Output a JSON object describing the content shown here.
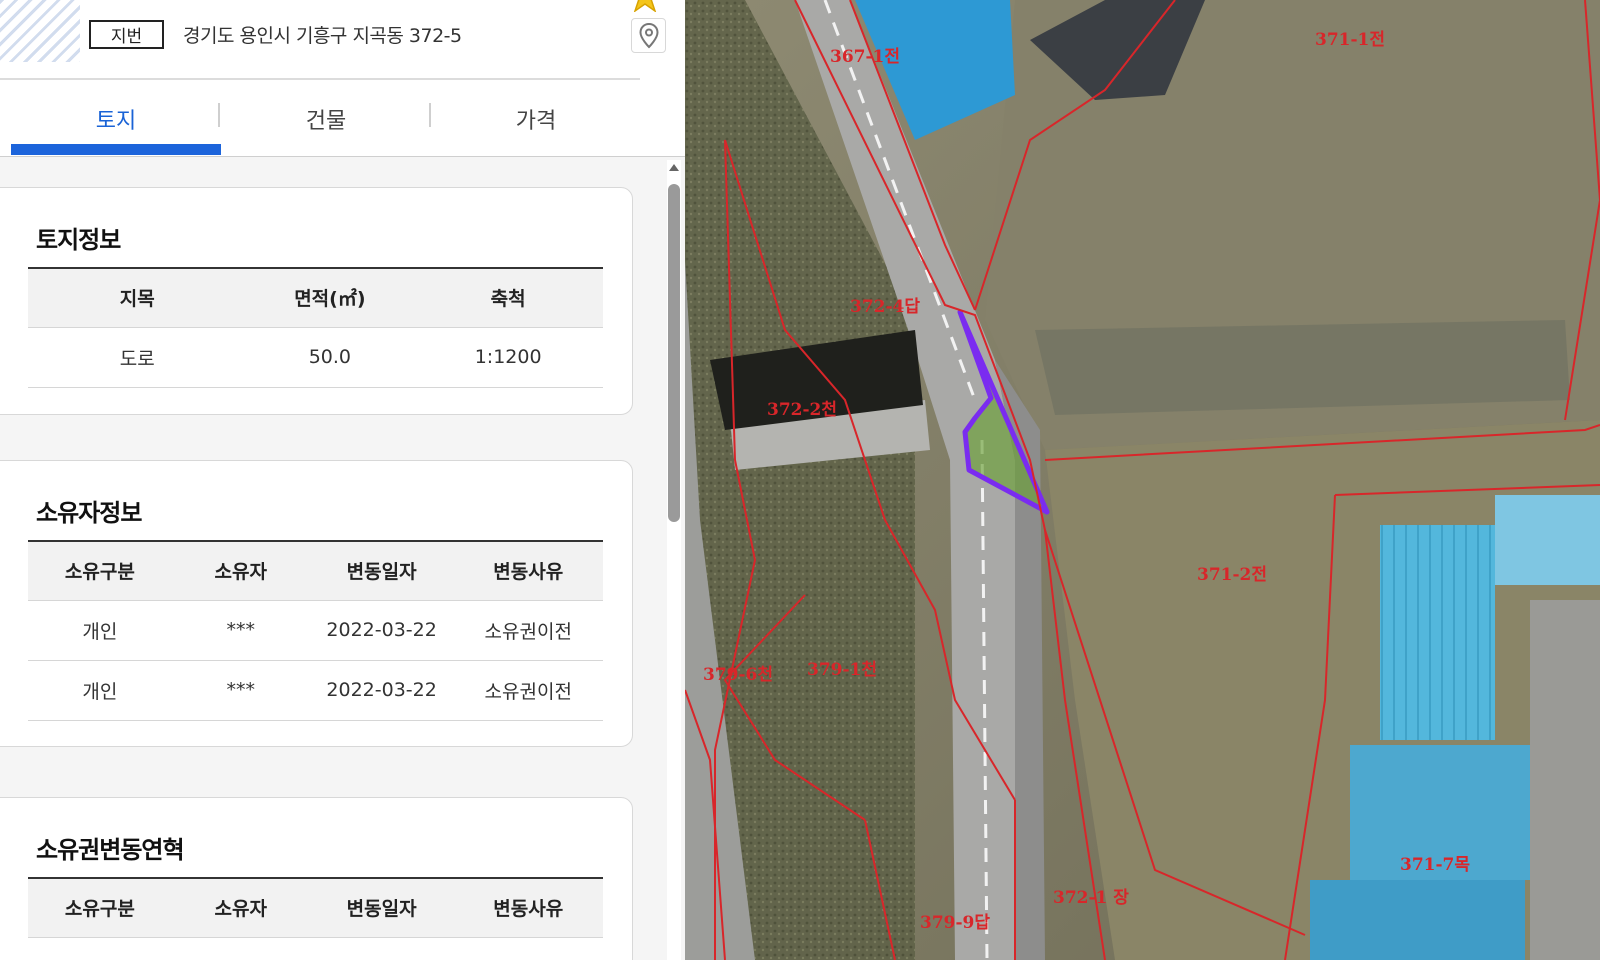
{
  "header": {
    "badge": "지번",
    "address": "경기도 용인시 기흥구 지곡동 372-5"
  },
  "tabs": [
    {
      "label": "토지",
      "active": true
    },
    {
      "label": "건물",
      "active": false
    },
    {
      "label": "가격",
      "active": false
    }
  ],
  "land_info": {
    "title": "토지정보",
    "headers": [
      "지목",
      "면적(㎡)",
      "축척"
    ],
    "row": [
      "도로",
      "50.0",
      "1:1200"
    ]
  },
  "owner_info": {
    "title": "소유자정보",
    "headers": [
      "소유구분",
      "소유자",
      "변동일자",
      "변동사유"
    ],
    "rows": [
      [
        "개인",
        "***",
        "2022-03-22",
        "소유권이전"
      ],
      [
        "개인",
        "***",
        "2022-03-22",
        "소유권이전"
      ]
    ]
  },
  "ownership_history": {
    "title": "소유권변동연혁",
    "headers": [
      "소유구분",
      "소유자",
      "변동일자",
      "변동사유"
    ]
  },
  "map": {
    "parcel_labels": [
      "367-1전",
      "371-1전",
      "372-4답",
      "372-2천",
      "371-2전",
      "379-6천",
      "379-1천",
      "372-1 장",
      "379-9답",
      "371-7목"
    ],
    "boundary_color": "#d8262a",
    "selected_parcel_color": "#7a2cf0"
  },
  "colors": {
    "accent": "#1c64db"
  }
}
